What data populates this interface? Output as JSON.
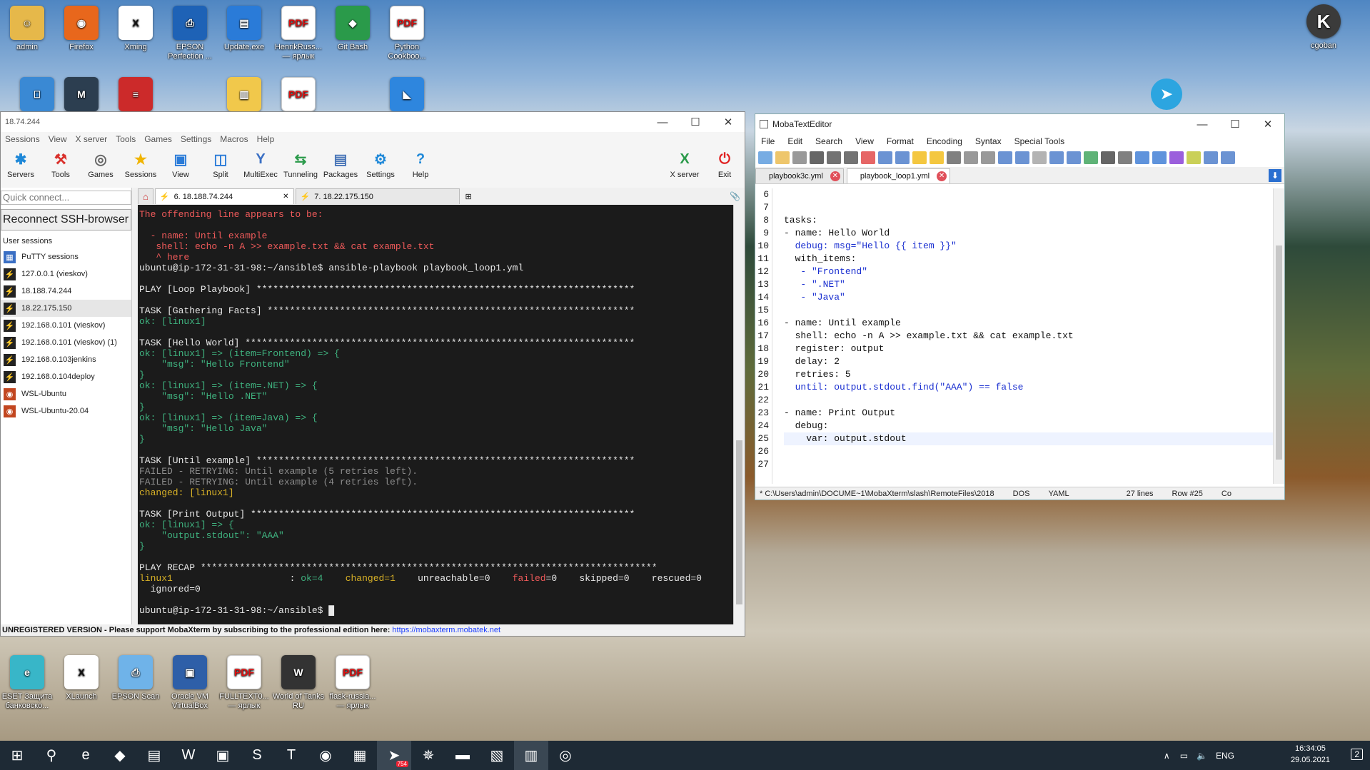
{
  "desktop": {
    "top_icons": [
      {
        "label": "admin",
        "color": "#e6b84a",
        "glyph": "☺"
      },
      {
        "label": "Firefox",
        "color": "#e8671c",
        "glyph": "◉"
      },
      {
        "label": "Xming",
        "color": "#ffffff",
        "glyph": "X"
      },
      {
        "label": "EPSON Perfection ...",
        "color": "#1e62b6",
        "glyph": "⎙"
      },
      {
        "label": "Update.exe",
        "color": "#2a7bd8",
        "glyph": "▤"
      },
      {
        "label": "HenrikRuss... — ярлык",
        "color": "#ffffff",
        "glyph": "PDF"
      },
      {
        "label": "Git Bash",
        "color": "#2a9a4a",
        "glyph": "◆"
      },
      {
        "label": "Python Cookboo...",
        "color": "#ffffff",
        "glyph": "PDF"
      }
    ],
    "second_row_icons": [
      {
        "label": "",
        "color": "#3a89d4",
        "glyph": "⎕"
      },
      {
        "label": "",
        "color": "#2c3e50",
        "glyph": "M"
      },
      {
        "label": "",
        "color": "#cc2a2a",
        "glyph": "≡"
      },
      {
        "label": "",
        "color": "#f1c84b",
        "glyph": "▥"
      },
      {
        "label": "",
        "color": "#ffffff",
        "glyph": "PDF"
      },
      {
        "label": "",
        "color": "#2e86de",
        "glyph": "◣"
      }
    ],
    "right_icon": {
      "label": "cgoban",
      "glyph": "K"
    },
    "telegram_icon": "telegram-icon",
    "bottom_icons": [
      {
        "label": "ESET Защита банковско...",
        "color": "#38b6c8",
        "glyph": "e"
      },
      {
        "label": "XLaunch",
        "color": "#ffffff",
        "glyph": "X"
      },
      {
        "label": "EPSON Scan",
        "color": "#6fb3e9",
        "glyph": "⎙"
      },
      {
        "label": "Oracle VM VirtualBox",
        "color": "#2e5fa8",
        "glyph": "▣"
      },
      {
        "label": "FULLTEXT0... — ярлык",
        "color": "#ffffff",
        "glyph": "PDF"
      },
      {
        "label": "World of Tanks RU",
        "color": "#333333",
        "glyph": "W"
      },
      {
        "label": "flask-russia... — ярлык",
        "color": "#ffffff",
        "glyph": "PDF"
      }
    ]
  },
  "moba": {
    "title": "18.74.244",
    "menu": [
      "Sessions",
      "View",
      "X server",
      "Tools",
      "Games",
      "Settings",
      "Macros",
      "Help"
    ],
    "toolbar": [
      {
        "label": "Servers",
        "glyph": "✱",
        "color": "#1e88d8"
      },
      {
        "label": "Tools",
        "glyph": "⚒",
        "color": "#d9302b"
      },
      {
        "label": "Games",
        "glyph": "◎",
        "color": "#666666"
      },
      {
        "label": "Sessions",
        "glyph": "★",
        "color": "#f0b400"
      },
      {
        "label": "View",
        "glyph": "▣",
        "color": "#2a7bd8"
      },
      {
        "label": "Split",
        "glyph": "◫",
        "color": "#2a7bd8"
      },
      {
        "label": "MultiExec",
        "glyph": "Y",
        "color": "#3a6fc4"
      },
      {
        "label": "Tunneling",
        "glyph": "⇆",
        "color": "#2a9a4a"
      },
      {
        "label": "Packages",
        "glyph": "▤",
        "color": "#4a76b8"
      },
      {
        "label": "Settings",
        "glyph": "⚙",
        "color": "#1e88d8"
      },
      {
        "label": "Help",
        "glyph": "?",
        "color": "#1e88d8"
      }
    ],
    "toolbar_right": [
      {
        "label": "X server",
        "glyph": "X",
        "color": "#2a9a4a"
      },
      {
        "label": "Exit",
        "glyph": "⏻",
        "color": "#e02020"
      }
    ],
    "quick_connect_placeholder": "Quick connect...",
    "reconnect_button": "Reconnect SSH-browser",
    "sessions_header": "User sessions",
    "sessions": [
      {
        "label": "PuTTY sessions",
        "icon": "putty-folder-icon",
        "selected": false
      },
      {
        "label": "127.0.0.1 (vieskov)",
        "icon": "ssh-icon",
        "selected": false
      },
      {
        "label": "18.188.74.244",
        "icon": "ssh-icon",
        "selected": false
      },
      {
        "label": "18.22.175.150",
        "icon": "ssh-icon",
        "selected": true
      },
      {
        "label": "192.168.0.101 (vieskov)",
        "icon": "ssh-icon",
        "selected": false
      },
      {
        "label": "192.168.0.101 (vieskov) (1)",
        "icon": "ssh-icon",
        "selected": false
      },
      {
        "label": "192.168.0.103jenkins",
        "icon": "ssh-icon",
        "selected": false
      },
      {
        "label": "192.168.0.104deploy",
        "icon": "ssh-icon",
        "selected": false
      },
      {
        "label": "WSL-Ubuntu",
        "icon": "wsl-icon",
        "selected": false
      },
      {
        "label": "WSL-Ubuntu-20.04",
        "icon": "wsl-icon",
        "selected": false
      }
    ],
    "tabs": [
      {
        "label": "6. 18.188.74.244",
        "active": true
      },
      {
        "label": "7. 18.22.175.150",
        "active": false
      }
    ],
    "terminal_lines": [
      {
        "parts": [
          {
            "t": "The offending line appears to be:",
            "c": "red"
          }
        ]
      },
      {
        "parts": [
          {
            "t": "",
            "c": "wht"
          }
        ]
      },
      {
        "parts": [
          {
            "t": "  - name: Until example",
            "c": "red"
          }
        ]
      },
      {
        "parts": [
          {
            "t": "   shell: echo -n A >> example.txt && cat example.txt",
            "c": "red"
          }
        ]
      },
      {
        "parts": [
          {
            "t": "   ^ here",
            "c": "red"
          }
        ]
      },
      {
        "parts": [
          {
            "t": "ubuntu@ip-172-31-31-98:~/ansible$ ansible-playbook playbook_loop1.yml",
            "c": "wht"
          }
        ]
      },
      {
        "parts": [
          {
            "t": "",
            "c": "wht"
          }
        ]
      },
      {
        "parts": [
          {
            "t": "PLAY [Loop Playbook] ********************************************************************",
            "c": "wht"
          }
        ]
      },
      {
        "parts": [
          {
            "t": "",
            "c": "wht"
          }
        ]
      },
      {
        "parts": [
          {
            "t": "TASK [Gathering Facts] ******************************************************************",
            "c": "wht"
          }
        ]
      },
      {
        "parts": [
          {
            "t": "ok: [linux1]",
            "c": "grn"
          }
        ]
      },
      {
        "parts": [
          {
            "t": "",
            "c": "wht"
          }
        ]
      },
      {
        "parts": [
          {
            "t": "TASK [Hello World] **********************************************************************",
            "c": "wht"
          }
        ]
      },
      {
        "parts": [
          {
            "t": "ok: [linux1] => (item=Frontend) => {",
            "c": "grn"
          }
        ]
      },
      {
        "parts": [
          {
            "t": "    \"msg\": \"Hello Frontend\"",
            "c": "grn"
          }
        ]
      },
      {
        "parts": [
          {
            "t": "}",
            "c": "grn"
          }
        ]
      },
      {
        "parts": [
          {
            "t": "ok: [linux1] => (item=.NET) => {",
            "c": "grn"
          }
        ]
      },
      {
        "parts": [
          {
            "t": "    \"msg\": \"Hello .NET\"",
            "c": "grn"
          }
        ]
      },
      {
        "parts": [
          {
            "t": "}",
            "c": "grn"
          }
        ]
      },
      {
        "parts": [
          {
            "t": "ok: [linux1] => (item=Java) => {",
            "c": "grn"
          }
        ]
      },
      {
        "parts": [
          {
            "t": "    \"msg\": \"Hello Java\"",
            "c": "grn"
          }
        ]
      },
      {
        "parts": [
          {
            "t": "}",
            "c": "grn"
          }
        ]
      },
      {
        "parts": [
          {
            "t": "",
            "c": "wht"
          }
        ]
      },
      {
        "parts": [
          {
            "t": "TASK [Until example] ********************************************************************",
            "c": "wht"
          }
        ]
      },
      {
        "parts": [
          {
            "t": "FAILED - RETRYING: Until example (5 retries left).",
            "c": "gry"
          }
        ]
      },
      {
        "parts": [
          {
            "t": "FAILED - RETRYING: Until example (4 retries left).",
            "c": "gry"
          }
        ]
      },
      {
        "parts": [
          {
            "t": "changed: [linux1]",
            "c": "yel"
          }
        ]
      },
      {
        "parts": [
          {
            "t": "",
            "c": "wht"
          }
        ]
      },
      {
        "parts": [
          {
            "t": "TASK [Print Output] *********************************************************************",
            "c": "wht"
          }
        ]
      },
      {
        "parts": [
          {
            "t": "ok: [linux1] => {",
            "c": "grn"
          }
        ]
      },
      {
        "parts": [
          {
            "t": "    \"output.stdout\": \"AAA\"",
            "c": "grn"
          }
        ]
      },
      {
        "parts": [
          {
            "t": "}",
            "c": "grn"
          }
        ]
      },
      {
        "parts": [
          {
            "t": "",
            "c": "wht"
          }
        ]
      },
      {
        "parts": [
          {
            "t": "PLAY RECAP **********************************************************************************",
            "c": "wht"
          }
        ]
      },
      {
        "parts": [
          {
            "t": "linux1",
            "c": "yel"
          },
          {
            "t": "                     : ",
            "c": "wht"
          },
          {
            "t": "ok=4",
            "c": "grn"
          },
          {
            "t": "    ",
            "c": "wht"
          },
          {
            "t": "changed=1",
            "c": "yel"
          },
          {
            "t": "    unreachable=0    ",
            "c": "wht"
          },
          {
            "t": "failed",
            "c": "red"
          },
          {
            "t": "=0    skipped=0    rescued=0",
            "c": "wht"
          }
        ]
      },
      {
        "parts": [
          {
            "t": "  ignored=0",
            "c": "wht"
          }
        ]
      },
      {
        "parts": [
          {
            "t": "",
            "c": "wht"
          }
        ]
      },
      {
        "parts": [
          {
            "t": "ubuntu@ip-172-31-31-98:~/ansible$ █",
            "c": "wht"
          }
        ]
      }
    ],
    "status_text": "UNREGISTERED VERSION  -  Please support MobaXterm by subscribing to the professional edition here:  ",
    "status_link": "https://mobaxterm.mobatek.net"
  },
  "editor": {
    "title": "MobaTextEditor",
    "menu": [
      "File",
      "Edit",
      "Search",
      "View",
      "Format",
      "Encoding",
      "Syntax",
      "Special Tools"
    ],
    "tabs": [
      {
        "label": "playbook3c.yml",
        "active": false
      },
      {
        "label": "playbook_loop1.yml",
        "active": true
      }
    ],
    "lines": [
      {
        "n": "6",
        "text": ""
      },
      {
        "n": "7",
        "text": ""
      },
      {
        "n": "8",
        "text": "tasks:"
      },
      {
        "n": "9",
        "text": "- name: Hello World"
      },
      {
        "n": "10",
        "text": "  debug: msg=\"Hello {{ item }}\""
      },
      {
        "n": "11",
        "text": "  with_items:"
      },
      {
        "n": "12",
        "text": "   - \"Frontend\""
      },
      {
        "n": "13",
        "text": "   - \".NET\""
      },
      {
        "n": "14",
        "text": "   - \"Java\""
      },
      {
        "n": "15",
        "text": ""
      },
      {
        "n": "16",
        "text": "- name: Until example"
      },
      {
        "n": "17",
        "text": "  shell: echo -n A >> example.txt && cat example.txt"
      },
      {
        "n": "18",
        "text": "  register: output"
      },
      {
        "n": "19",
        "text": "  delay: 2"
      },
      {
        "n": "20",
        "text": "  retries: 5"
      },
      {
        "n": "21",
        "text": "  until: output.stdout.find(\"AAA\") == false"
      },
      {
        "n": "22",
        "text": ""
      },
      {
        "n": "23",
        "text": "- name: Print Output"
      },
      {
        "n": "24",
        "text": "  debug:"
      },
      {
        "n": "25",
        "text": "    var: output.stdout"
      },
      {
        "n": "26",
        "text": ""
      },
      {
        "n": "27",
        "text": ""
      }
    ],
    "current_line": "25",
    "status": {
      "path": "* C:\\Users\\admin\\DOCUME~1\\MobaXterm\\slash\\RemoteFiles\\2018",
      "eol": "DOS",
      "syntax": "YAML",
      "lines": "27 lines",
      "row": "Row #25",
      "col": "Co"
    }
  },
  "taskbar": {
    "icons": [
      {
        "name": "start-icon",
        "glyph": "⊞",
        "active": false
      },
      {
        "name": "search-icon",
        "glyph": "⚲",
        "active": false
      },
      {
        "name": "edge-icon",
        "glyph": "e",
        "active": false
      },
      {
        "name": "visual-studio-icon",
        "glyph": "◆",
        "active": false
      },
      {
        "name": "file-explorer-icon",
        "glyph": "▤",
        "active": false
      },
      {
        "name": "word-icon",
        "glyph": "W",
        "active": false
      },
      {
        "name": "sticky-icon",
        "glyph": "▣",
        "active": false
      },
      {
        "name": "skype-icon",
        "glyph": "S",
        "active": false
      },
      {
        "name": "teams-icon",
        "glyph": "T",
        "active": false
      },
      {
        "name": "firefox-icon",
        "glyph": "◉",
        "active": false
      },
      {
        "name": "app-icon",
        "glyph": "▦",
        "active": false
      },
      {
        "name": "telegram-taskbar-icon",
        "glyph": "➤",
        "active": true
      },
      {
        "name": "settings-wheel-icon",
        "glyph": "✵",
        "active": false
      },
      {
        "name": "mobaxterm-icon",
        "glyph": "▬",
        "active": false
      },
      {
        "name": "image-viewer-icon",
        "glyph": "▧",
        "active": false
      },
      {
        "name": "mobatexteditor-icon",
        "glyph": "▥",
        "active": true
      },
      {
        "name": "media-icon",
        "glyph": "◎",
        "active": false
      }
    ],
    "telegram_badge": "754",
    "lang": "ENG",
    "time": "16:34:05",
    "date": "29.05.2021",
    "notif_count": "2"
  }
}
